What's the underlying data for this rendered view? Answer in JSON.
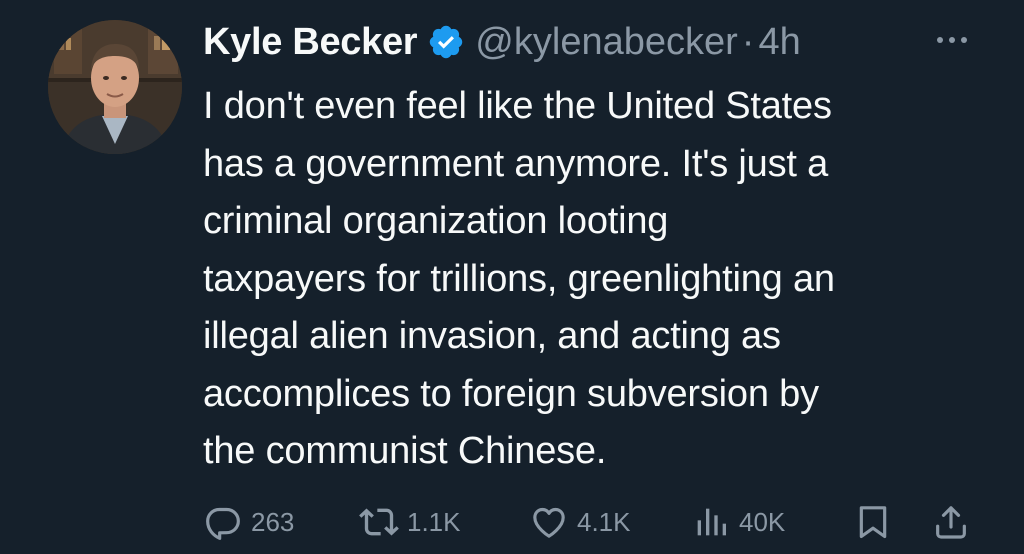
{
  "author": {
    "name": "Kyle Becker",
    "handle": "@kylenabecker",
    "separator": "·",
    "time": "4h",
    "verified": true
  },
  "tweet": {
    "lines": [
      "I don't even feel like the United States",
      "has a government anymore. It's just a",
      "criminal organization looting",
      "taxpayers for trillions, greenlighting an",
      "illegal alien invasion, and acting as",
      "accomplices to foreign subversion by",
      "the communist Chinese."
    ]
  },
  "actions": {
    "reply": {
      "icon": "reply-icon",
      "count": "263"
    },
    "retweet": {
      "icon": "retweet-icon",
      "count": "1.1K"
    },
    "like": {
      "icon": "heart-icon",
      "count": "4.1K"
    },
    "views": {
      "icon": "views-icon",
      "count": "40K"
    },
    "bookmark": {
      "icon": "bookmark-icon"
    },
    "share": {
      "icon": "share-icon"
    }
  },
  "colors": {
    "background": "#15202b",
    "text": "#f7f9f9",
    "muted": "#8b98a5",
    "verified": "#1d9bf0"
  }
}
